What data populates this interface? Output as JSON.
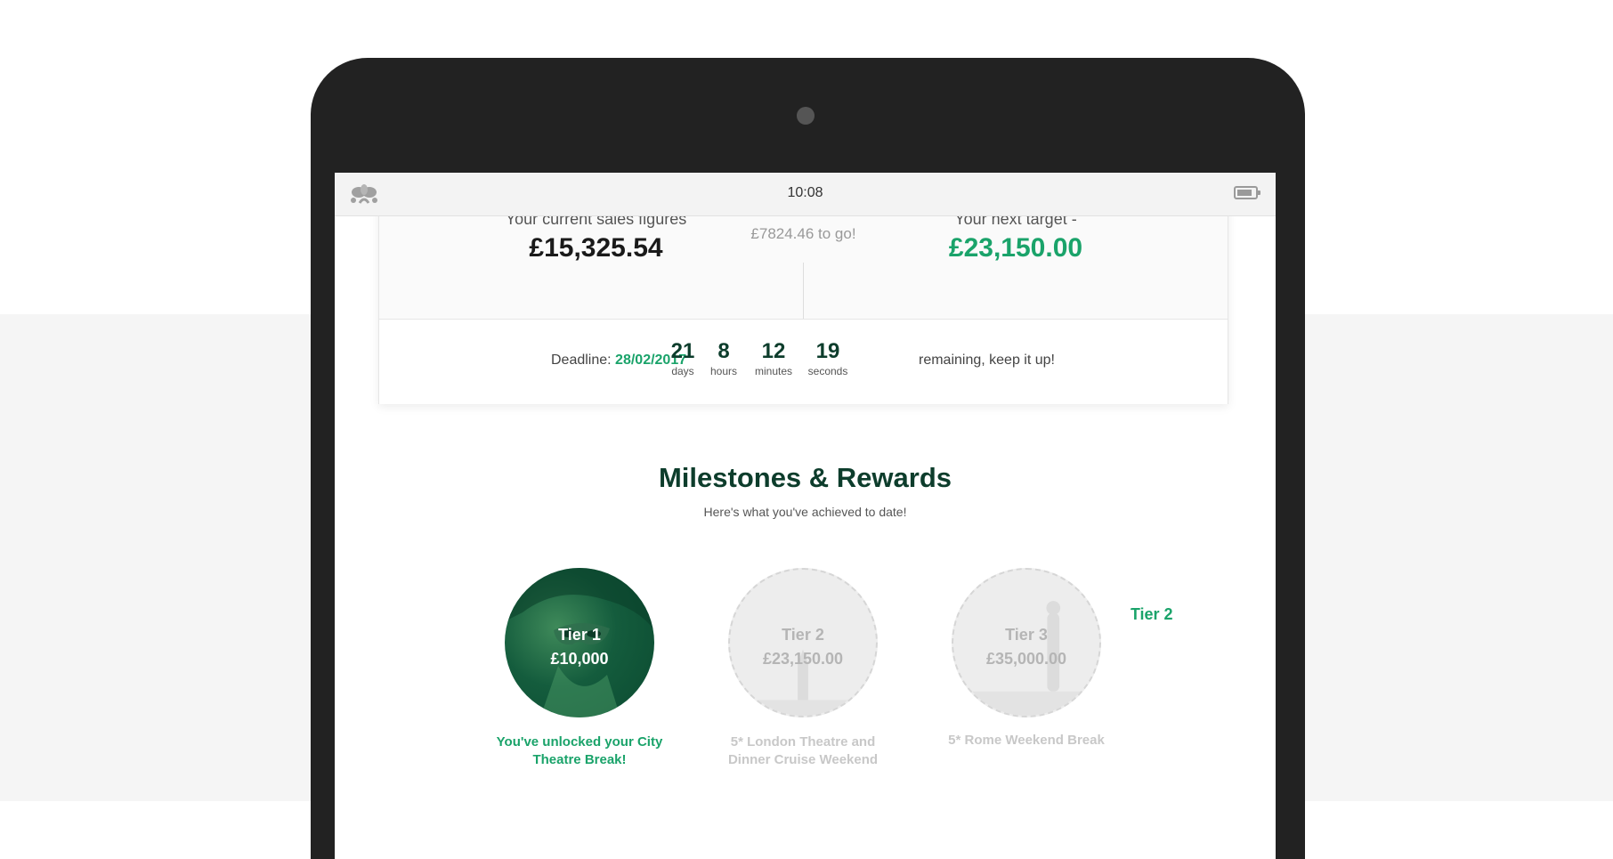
{
  "status_bar": {
    "time": "10:08"
  },
  "sales": {
    "current_label": "Your current sales figures",
    "current_value": "£15,325.54",
    "to_go": "£7824.46 to go!",
    "next_label_prefix": "Your next target - ",
    "next_tier": "Tier 2",
    "next_value": "£23,150.00"
  },
  "deadline": {
    "label": "Deadline: ",
    "date": "28/02/2017",
    "countdown": [
      {
        "value": "21",
        "unit": "days"
      },
      {
        "value": "8",
        "unit": "hours"
      },
      {
        "value": "12",
        "unit": "minutes"
      },
      {
        "value": "19",
        "unit": "seconds"
      }
    ],
    "remaining_text": "remaining, keep it up!"
  },
  "milestones": {
    "title": "Milestones & Rewards",
    "subtitle": "Here's what you've achieved to date!",
    "tiers": [
      {
        "name": "Tier 1",
        "amount": "£10,000",
        "caption": "You've unlocked your City Theatre Break!",
        "unlocked": true
      },
      {
        "name": "Tier 2",
        "amount": "£23,150.00",
        "caption": "5* London Theatre and Dinner Cruise Weekend",
        "unlocked": false
      },
      {
        "name": "Tier 3",
        "amount": "£35,000.00",
        "caption": "5* Rome Weekend Break",
        "unlocked": false
      }
    ]
  },
  "colors": {
    "accent_green": "#1aa36a",
    "dark_green": "#0d3d2c",
    "device_frame": "#222222",
    "page_bg_lower": "#f5f5f5"
  },
  "icons": [
    "app-logo-icon",
    "battery-icon",
    "camera-dot"
  ]
}
